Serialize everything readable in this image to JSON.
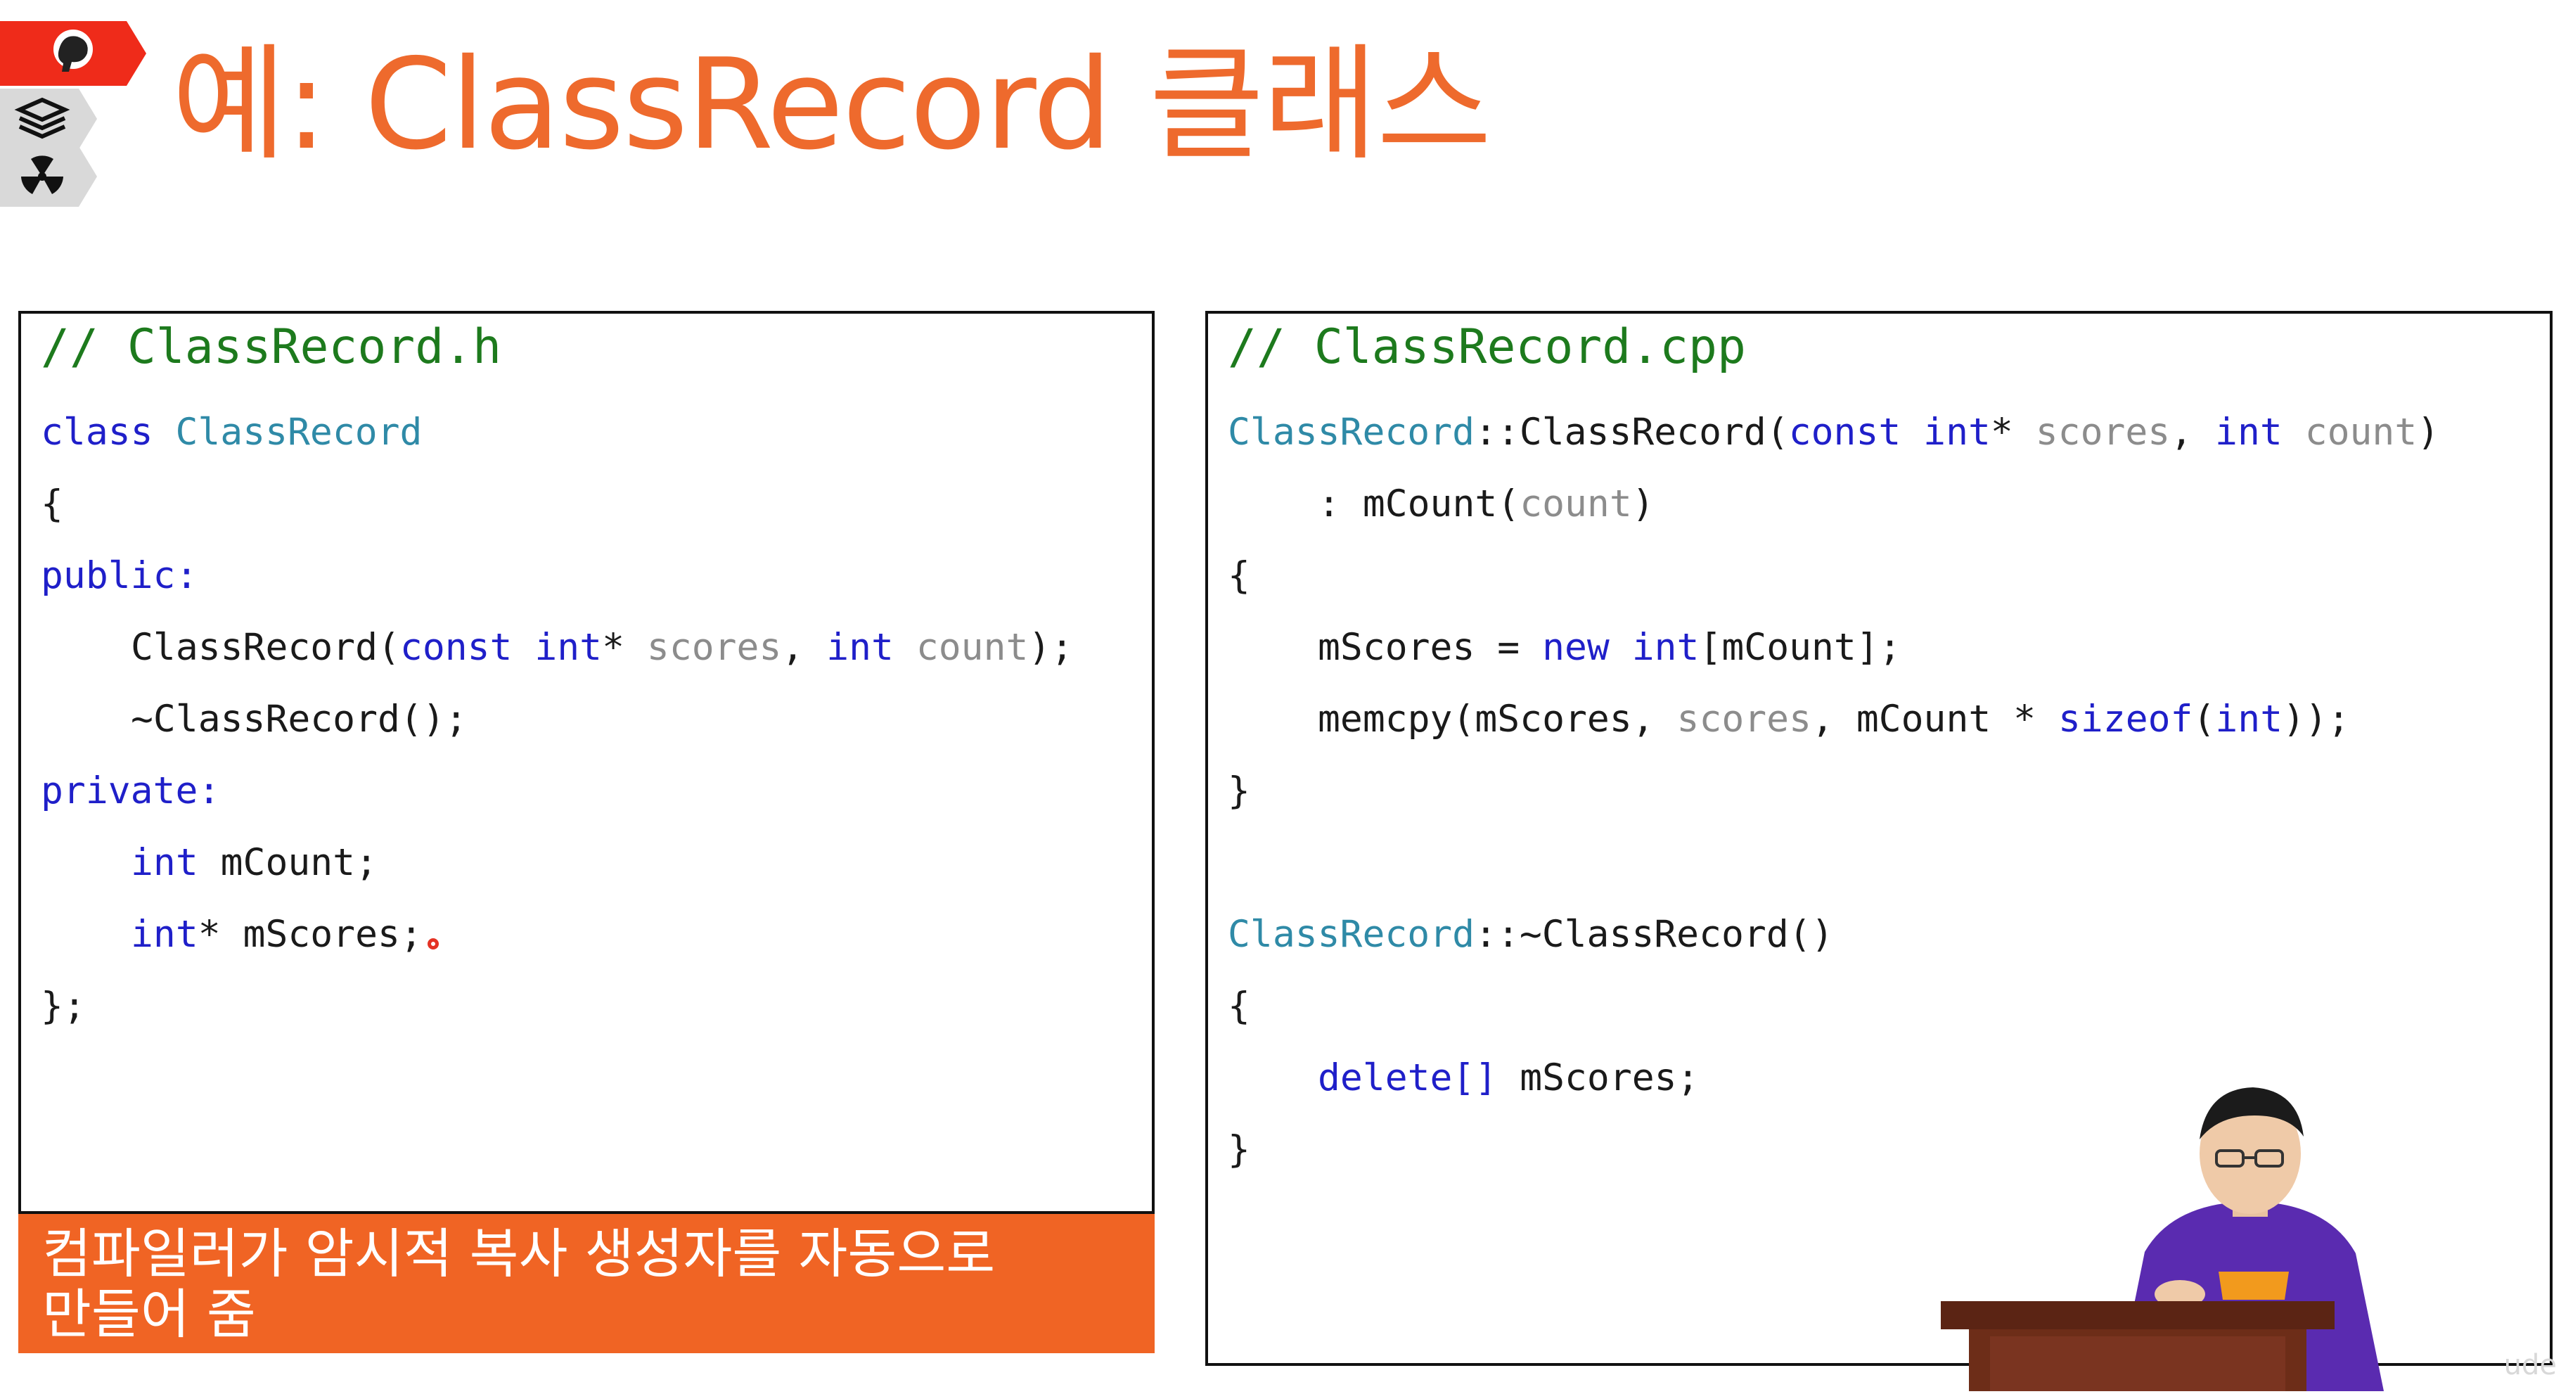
{
  "title": "예: ClassRecord 클래스",
  "icons": {
    "brain_badge": "brain-icon",
    "books_badge": "books-icon",
    "hazard_badge": "radiation-icon",
    "accent_color": "#ee6a2d",
    "badge_red": "#ef2b1a"
  },
  "header_file": {
    "comment": "// ClassRecord.h",
    "lines": {
      "l1_kw": "class",
      "l1_name": "ClassRecord",
      "l2": "{",
      "l3": "public:",
      "l4_a": "ClassRecord(",
      "l4_b": "const int",
      "l4_c": "* ",
      "l4_d": "scores",
      "l4_e": ", ",
      "l4_f": "int",
      "l4_g": " ",
      "l4_h": "count",
      "l4_i": ");",
      "l5": "~ClassRecord();",
      "l6": "private:",
      "l7_kw": "int",
      "l7_rest": " mCount;",
      "l8_kw": "int",
      "l8_rest": "* mScores;",
      "l9": "};"
    }
  },
  "cpp_file": {
    "comment": "// ClassRecord.cpp",
    "lines": {
      "l1_a": "ClassRecord",
      "l1_b": "::ClassRecord(",
      "l1_c": "const int",
      "l1_d": "* ",
      "l1_e": "scores",
      "l1_f": ", ",
      "l1_g": "int",
      "l1_h": " ",
      "l1_i": "count",
      "l1_j": ")",
      "l2_a": ": mCount(",
      "l2_b": "count",
      "l2_c": ")",
      "l3": "{",
      "l4_a": "mScores = ",
      "l4_b": "new int",
      "l4_c": "[mCount];",
      "l5_a": "memcpy(mScores, ",
      "l5_b": "scores",
      "l5_c": ", mCount * ",
      "l5_d": "sizeof",
      "l5_e": "(",
      "l5_f": "int",
      "l5_g": "));",
      "l6": "}",
      "l7_a": "ClassRecord",
      "l7_b": "::~ClassRecord()",
      "l8": "{",
      "l9_a": "delete[]",
      "l9_b": " mScores;",
      "l10": "}"
    }
  },
  "caption": {
    "line1": "컴파일러가 암시적 복사 생성자를 자동으로",
    "line2": "만들어 줌"
  },
  "watermark": "ude"
}
